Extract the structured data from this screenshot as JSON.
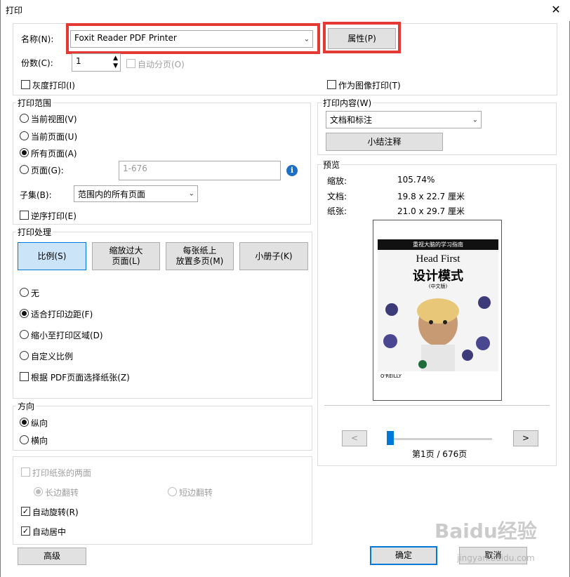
{
  "window": {
    "title": "打印",
    "close_glyph": "✕"
  },
  "printer": {
    "name_label": "名称(N):",
    "name_value": "Foxit Reader PDF Printer",
    "properties_button": "属性(P)",
    "copies_label": "份数(C):",
    "copies_value": "1",
    "collate_label": "自动分页(O)",
    "grayscale_label": "灰度打印(I)",
    "print_as_image_label": "作为图像打印(T)"
  },
  "range": {
    "group_label": "打印范围",
    "current_view": "当前视图(V)",
    "current_page": "当前页面(U)",
    "all_pages": "所有页面(A)",
    "pages": "页面(G):",
    "pages_placeholder": "1-676",
    "subset_label": "子集(B):",
    "subset_value": "范围内的所有页面",
    "reverse_label": "逆序打印(E)"
  },
  "handling": {
    "group_label": "打印处理",
    "buttons": [
      "比例(S)",
      "缩放过大\n页面(L)",
      "每张纸上\n放置多页(M)",
      "小册子(K)"
    ],
    "none": "无",
    "fit_margins": "适合打印边距(F)",
    "shrink": "缩小至打印区域(D)",
    "custom": "自定义比例",
    "by_pdf_size": "根据 PDF页面选择纸张(Z)"
  },
  "orientation": {
    "group_label": "方向",
    "portrait": "纵向",
    "landscape": "横向"
  },
  "duplex": {
    "both_sides": "打印纸张的两面",
    "long_edge": "长边翻转",
    "short_edge": "短边翻转",
    "auto_rotate": "自动旋转(R)",
    "auto_center": "自动居中"
  },
  "content": {
    "group_label": "打印内容(W)",
    "value": "文档和标注",
    "summarize_button": "小结注释"
  },
  "preview": {
    "group_label": "预览",
    "zoom_label": "缩放:",
    "zoom_value": "105.74%",
    "doc_label": "文档:",
    "doc_value": "19.8 x 22.7 厘米",
    "paper_label": "纸张:",
    "paper_value": "21.0 x 29.7 厘米",
    "page_indicator": "第1页 / 676页",
    "prev": "<",
    "next": ">",
    "book_series": "重视大脑的学习指南",
    "book_title_en": "Head First",
    "book_title_cn": "设计模式",
    "book_edition": "(中文版)",
    "book_publisher": "O'REILLY"
  },
  "footer": {
    "advanced": "高级",
    "ok": "确定",
    "cancel": "取消"
  },
  "watermark": {
    "brand": "Baidu经验",
    "url": "jingyan.baidu.com"
  }
}
